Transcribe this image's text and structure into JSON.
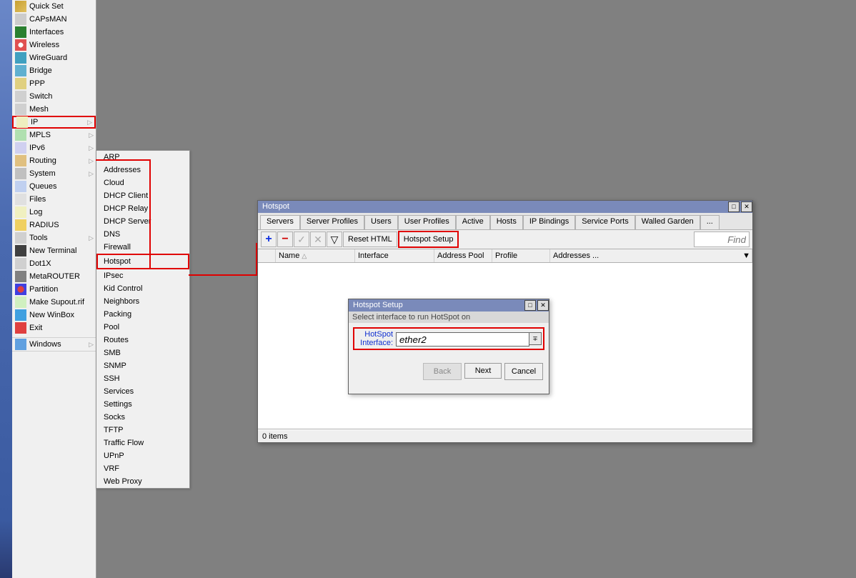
{
  "sidebar": [
    {
      "icon": "ic-quickset",
      "label": "Quick Set",
      "arrow": false
    },
    {
      "icon": "ic-caps",
      "label": "CAPsMAN",
      "arrow": false
    },
    {
      "icon": "ic-if",
      "label": "Interfaces",
      "arrow": false
    },
    {
      "icon": "ic-wl",
      "label": "Wireless",
      "arrow": false
    },
    {
      "icon": "ic-wg",
      "label": "WireGuard",
      "arrow": false
    },
    {
      "icon": "ic-br",
      "label": "Bridge",
      "arrow": false
    },
    {
      "icon": "ic-ppp",
      "label": "PPP",
      "arrow": false
    },
    {
      "icon": "ic-sw",
      "label": "Switch",
      "arrow": false
    },
    {
      "icon": "ic-mesh",
      "label": "Mesh",
      "arrow": false
    },
    {
      "icon": "ic-ip",
      "label": "IP",
      "arrow": true,
      "hl": true
    },
    {
      "icon": "ic-mpls",
      "label": "MPLS",
      "arrow": true
    },
    {
      "icon": "ic-ipv6",
      "label": "IPv6",
      "arrow": true
    },
    {
      "icon": "ic-route",
      "label": "Routing",
      "arrow": true
    },
    {
      "icon": "ic-sys",
      "label": "System",
      "arrow": true
    },
    {
      "icon": "ic-queue",
      "label": "Queues",
      "arrow": false
    },
    {
      "icon": "ic-files",
      "label": "Files",
      "arrow": false
    },
    {
      "icon": "ic-log",
      "label": "Log",
      "arrow": false
    },
    {
      "icon": "ic-radius",
      "label": "RADIUS",
      "arrow": false
    },
    {
      "icon": "ic-tools",
      "label": "Tools",
      "arrow": true
    },
    {
      "icon": "ic-term",
      "label": "New Terminal",
      "arrow": false
    },
    {
      "icon": "ic-dot1x",
      "label": "Dot1X",
      "arrow": false
    },
    {
      "icon": "ic-meta",
      "label": "MetaROUTER",
      "arrow": false
    },
    {
      "icon": "ic-part",
      "label": "Partition",
      "arrow": false
    },
    {
      "icon": "ic-supout",
      "label": "Make Supout.rif",
      "arrow": false
    },
    {
      "icon": "ic-nwb",
      "label": "New WinBox",
      "arrow": false
    },
    {
      "icon": "ic-exit",
      "label": "Exit",
      "arrow": false
    }
  ],
  "sidebar_windows": {
    "icon": "ic-win",
    "label": "Windows",
    "arrow": true
  },
  "submenu": [
    "ARP",
    "Addresses",
    "Cloud",
    "DHCP Client",
    "DHCP Relay",
    "DHCP Server",
    "DNS",
    "Firewall",
    "Hotspot",
    "IPsec",
    "Kid Control",
    "Neighbors",
    "Packing",
    "Pool",
    "Routes",
    "SMB",
    "SNMP",
    "SSH",
    "Services",
    "Settings",
    "Socks",
    "TFTP",
    "Traffic Flow",
    "UPnP",
    "VRF",
    "Web Proxy"
  ],
  "submenu_hl": "Hotspot",
  "hotspot": {
    "title": "Hotspot",
    "tabs": [
      "Servers",
      "Server Profiles",
      "Users",
      "User Profiles",
      "Active",
      "Hosts",
      "IP Bindings",
      "Service Ports",
      "Walled Garden",
      "..."
    ],
    "active_tab": "Servers",
    "reset_btn": "Reset HTML",
    "setup_btn": "Hotspot Setup",
    "find": "Find",
    "columns": [
      "Name",
      "Interface",
      "Address Pool",
      "Profile",
      "Addresses ..."
    ],
    "footer": "0 items"
  },
  "setup": {
    "title": "Hotspot Setup",
    "subtitle": "Select interface to run HotSpot on",
    "label": "HotSpot Interface:",
    "value": "ether2",
    "back": "Back",
    "next": "Next",
    "cancel": "Cancel"
  }
}
